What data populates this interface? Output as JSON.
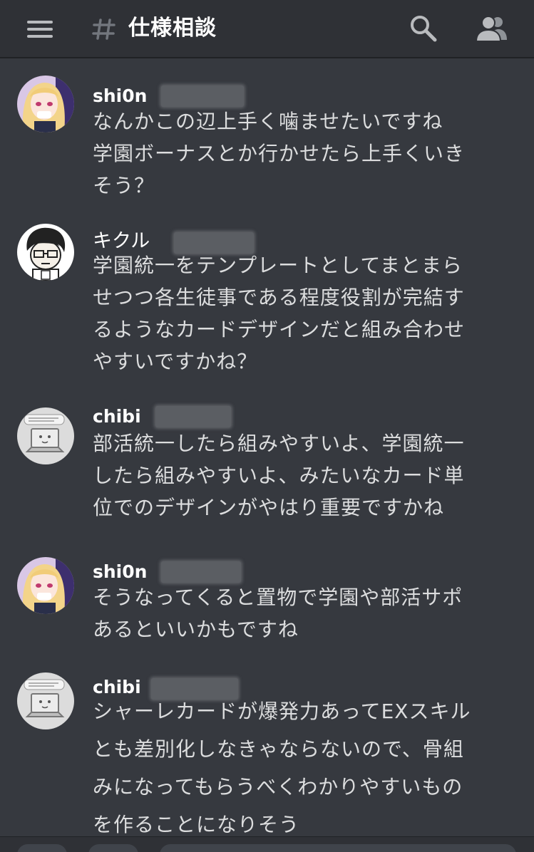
{
  "header": {
    "channel_name": "仕様相談",
    "menu_icon": "hamburger-menu-icon",
    "hash_icon": "channel-hash-icon",
    "search_icon": "search-icon",
    "members_icon": "members-icon"
  },
  "messages": [
    {
      "username": "shi0n",
      "avatar": "anime-girl-avatar",
      "lines": [
        "なんかこの辺上手く噛ませたいですね",
        "学園ボーナスとか行かせたら上手くいき",
        "そう？"
      ]
    },
    {
      "username": "キクル",
      "avatar": "cartoon-man-glasses-avatar",
      "lines": [
        "学園統一をテンプレートとしてまとまら",
        "せつつ各生徒事である程度役割が完結す",
        "るようなカードデザインだと組み合わせ",
        "やすいですかね？"
      ]
    },
    {
      "username": "chibi",
      "avatar": "laptop-avatar",
      "lines": [
        "部活統一したら組みやすいよ、学園統一",
        "したら組みやすいよ、みたいなカード単",
        "位でのデザインがやはり重要ですかね"
      ]
    },
    {
      "username": "shi0n",
      "avatar": "anime-girl-avatar",
      "lines": [
        "そうなってくると置物で学園や部活サポ",
        "あるといいかもですね"
      ]
    },
    {
      "username": "chibi",
      "avatar": "laptop-avatar",
      "lines": [
        "シャーレカードが爆発力あってEXスキル",
        "とも差別化しなきゃならないので、骨組",
        "みになってもらうべくわかりやすいもの",
        "を作ることになりそう"
      ]
    }
  ]
}
